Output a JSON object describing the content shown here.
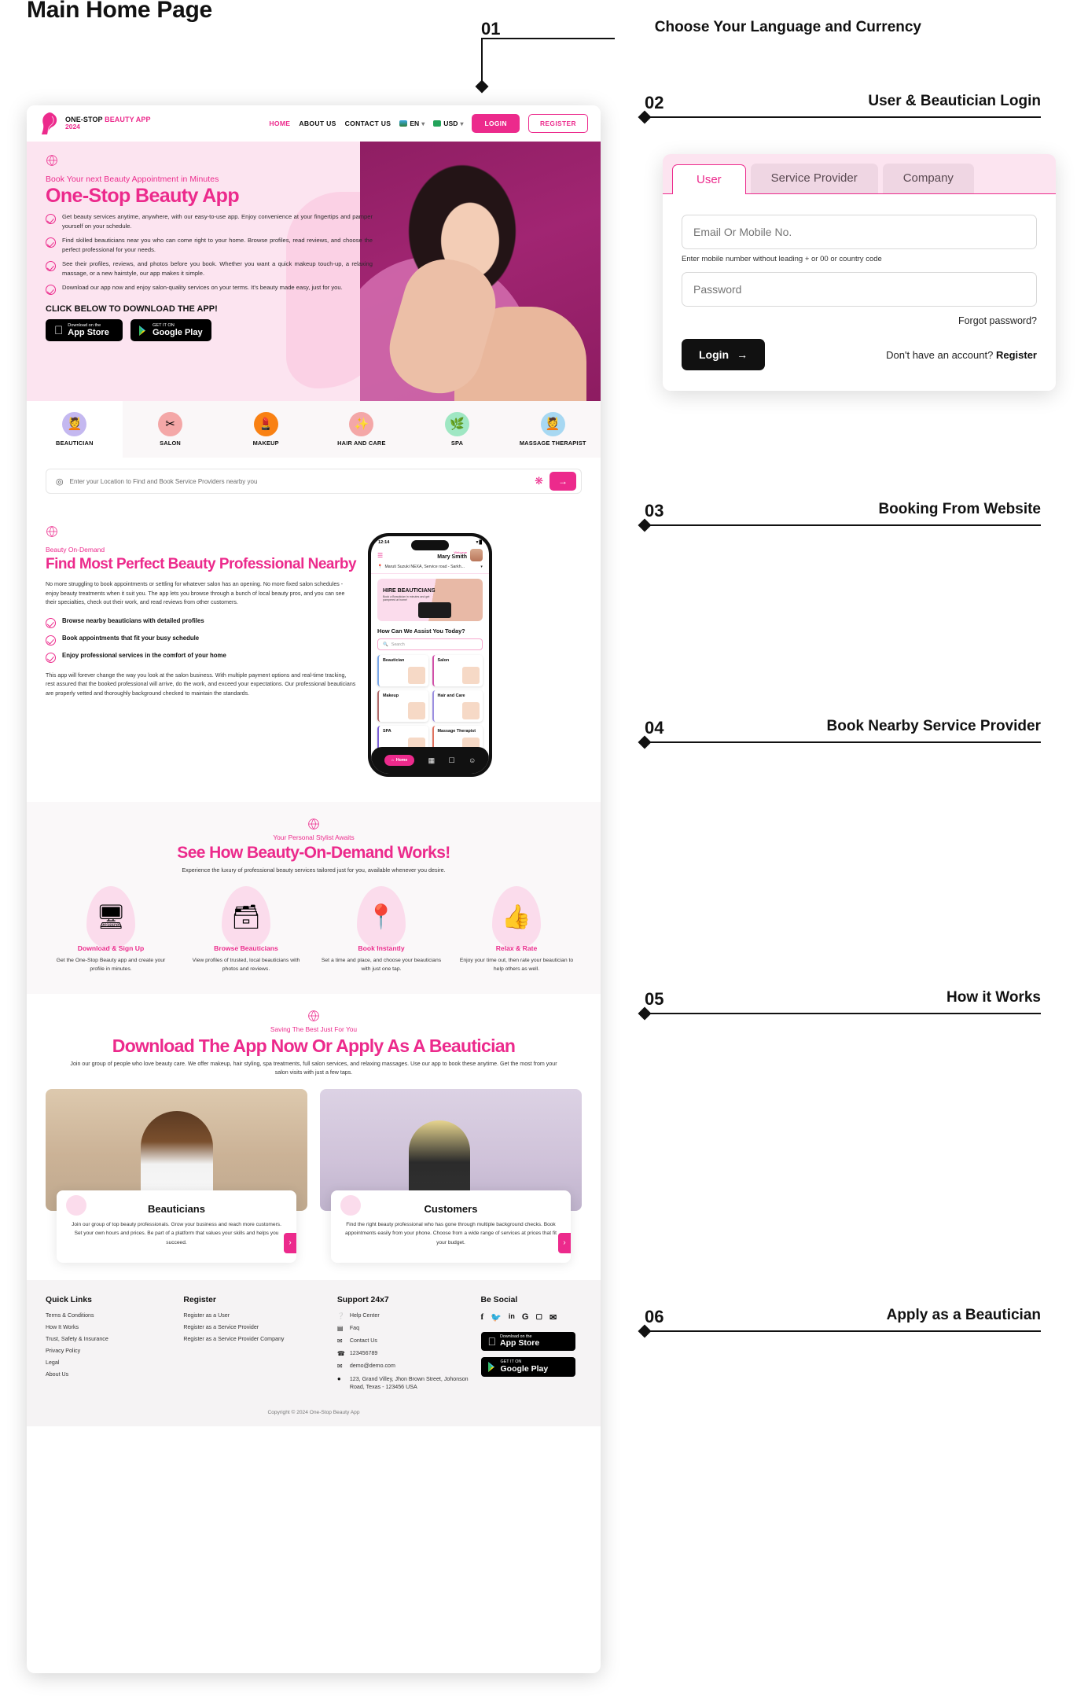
{
  "page_title": "Main Home Page",
  "callouts": [
    {
      "num": "01",
      "label": "Choose Your Language and Currency"
    },
    {
      "num": "02",
      "label": "User & Beautician Login"
    },
    {
      "num": "03",
      "label": "Booking From Website"
    },
    {
      "num": "04",
      "label": "Book Nearby Service Provider"
    },
    {
      "num": "05",
      "label": "How it Works"
    },
    {
      "num": "06",
      "label": "Apply as a Beautician"
    }
  ],
  "colors": {
    "accent": "#ec2a8c",
    "hero_bg": "#fce4f0",
    "photo_bg": "#8f1e63",
    "dark": "#111111"
  },
  "header": {
    "brand_line1_a": "ONE-STOP ",
    "brand_line1_b": "BEAUTY APP",
    "brand_line2": "2024",
    "nav": [
      {
        "label": "HOME",
        "active": true
      },
      {
        "label": "ABOUT US",
        "active": false
      },
      {
        "label": "CONTACT US",
        "active": false
      }
    ],
    "language": "EN",
    "currency": "USD",
    "login_label": "LOGIN",
    "register_label": "REGISTER"
  },
  "hero": {
    "kicker": "Book Your next Beauty Appointment in Minutes",
    "title": "One-Stop Beauty App",
    "bullets": [
      "Get beauty services anytime, anywhere, with our easy-to-use app. Enjoy convenience at your fingertips and pamper yourself on your schedule.",
      "Find skilled beauticians near you who can come right to your home. Browse profiles, read reviews, and choose the perfect professional for your needs.",
      "See their profiles, reviews, and photos before you book. Whether you want a quick makeup touch-up, a relaxing massage, or a new hairstyle, our app makes it simple.",
      "Download our app now and enjoy salon-quality services on your terms. It's beauty made easy, just for you."
    ],
    "cta_line": "CLICK BELOW TO DOWNLOAD THE APP!",
    "app_store": {
      "small": "Download on the",
      "big": "App Store"
    },
    "play_store": {
      "small": "GET IT ON",
      "big": "Google Play"
    }
  },
  "categories": [
    {
      "label": "BEAUTICIAN",
      "icon": "beautician-icon",
      "glyph": "💆",
      "bg": "#c4b8f0",
      "active": true
    },
    {
      "label": "SALON",
      "icon": "salon-icon",
      "glyph": "✂",
      "bg": "#f4a7a7",
      "active": false
    },
    {
      "label": "MAKEUP",
      "icon": "makeup-icon",
      "glyph": "💄",
      "bg": "#f98113",
      "active": false
    },
    {
      "label": "HAIR AND CARE",
      "icon": "hair-care-icon",
      "glyph": "💫",
      "bg": "#f4a7a7",
      "active": false
    },
    {
      "label": "SPA",
      "icon": "spa-icon",
      "glyph": "🌿",
      "bg": "#9fe7c3",
      "active": false
    },
    {
      "label": "MASSAGE THERAPIST",
      "icon": "massage-icon",
      "glyph": "💆",
      "bg": "#a7d8f2",
      "active": false
    }
  ],
  "location_search": {
    "placeholder": "Enter your Location to Find and Book Service Providers nearby you",
    "pin_icon": "location-pin-icon",
    "locate_icon": "crosshair-icon",
    "submit_icon": "arrow-right-icon"
  },
  "nearby": {
    "kicker": "Beauty On-Demand",
    "title": "Find Most Perfect Beauty Professional Nearby",
    "intro": "No more struggling to book appointments or settling for whatever salon has an opening. No more fixed salon schedules - enjoy beauty treatments when it suit you. The app lets you browse through a bunch of local beauty pros, and you can see their specialties, check out their work, and read reviews from other customers.",
    "bullets": [
      "Browse nearby beauticians with detailed profiles",
      "Book appointments that fit your busy schedule",
      "Enjoy professional services in the comfort of your home"
    ],
    "outro": "This app will forever change the way you look at the salon business. With multiple payment options and real-time tracking, rest assured that the booked professional will arrive, do the work, and exceed your expectations. Our professional beauticians are properly vetted and thoroughly background checked to maintain the standards."
  },
  "phone": {
    "time": "12:14",
    "welcome": "Welcome",
    "user_name": "Mary Smith",
    "location": "Maruti Suzuki NEXA, Service road - Sarkh...",
    "banner_title": "HIRE BEAUTICIANS",
    "banner_sub": "Book a Beautician in minutes and get pampered at home!",
    "question": "How Can We Assist You Today?",
    "search_placeholder": "Search",
    "grid": [
      "Beautician",
      "Salon",
      "Makeup",
      "Hair and Care",
      "SPA",
      "Massage Therapist"
    ],
    "nav_home": "Home"
  },
  "how_it_works": {
    "kicker": "Your Personal Stylist Awaits",
    "title": "See How Beauty-On-Demand Works!",
    "subtitle": "Experience the luxury of professional beauty services tailored just for you, available whenever you desire.",
    "steps": [
      {
        "icon": "signup-screen-icon",
        "glyph": "🖥",
        "title": "Download & Sign Up",
        "desc": "Get the One-Stop Beauty app and create your profile in minutes."
      },
      {
        "icon": "browse-grid-icon",
        "glyph": "🗂",
        "title": "Browse Beauticians",
        "desc": "View profiles of trusted, local beauticians with photos and reviews."
      },
      {
        "icon": "map-pin-icon",
        "glyph": "📍",
        "title": "Book Instantly",
        "desc": "Set a time and place, and choose your beauticians with just one tap."
      },
      {
        "icon": "thumbs-up-stars-icon",
        "glyph": "👍",
        "title": "Relax & Rate",
        "desc": "Enjoy your time out, then rate your beautician to help others as well."
      }
    ]
  },
  "download_apply": {
    "kicker": "Saving The Best Just For You",
    "title": "Download The App Now Or Apply As A Beautician",
    "subtitle": "Join our group of people who love beauty care. We offer makeup, hair styling, spa treatments, full salon services, and relaxing massages. Use our app to book these anytime. Get the most from your salon visits with just a few taps.",
    "cards": [
      {
        "title": "Beauticians",
        "desc": "Join our group of top beauty professionals. Grow your business and reach more customers. Set your own hours and prices. Be part of a platform that values your skills and helps you succeed.",
        "arrow_icon": "chevron-right-icon"
      },
      {
        "title": "Customers",
        "desc": "Find the right beauty professional who has gone through multiple background checks. Book appointments easily from your phone. Choose from a wide range of services at prices that fit your budget.",
        "arrow_icon": "chevron-right-icon"
      }
    ]
  },
  "footer": {
    "quick_links": {
      "heading": "Quick Links",
      "items": [
        "Terms & Conditions",
        "How It Works",
        "Trust, Safety & Insurance",
        "Privacy Policy",
        "Legal",
        "About Us"
      ]
    },
    "register": {
      "heading": "Register",
      "items": [
        "Register as a User",
        "Register as a Service Provider",
        "Register as a Service Provider Company"
      ]
    },
    "support": {
      "heading": "Support 24x7",
      "items": [
        {
          "icon": "help-circle-icon",
          "glyph": "?",
          "text": "Help Center"
        },
        {
          "icon": "faq-icon",
          "glyph": "☷",
          "text": "Faq"
        },
        {
          "icon": "contact-icon",
          "glyph": "✉",
          "text": "Contact Us"
        },
        {
          "icon": "phone-icon",
          "glyph": "☎",
          "text": "123456789"
        },
        {
          "icon": "mail-icon",
          "glyph": "✉",
          "text": "demo@demo.com"
        },
        {
          "icon": "location-pin-icon",
          "glyph": "📍",
          "text": "123, Grand Villey, Jhon Brown Street, Johonson Road, Texas - 123456 USA"
        }
      ]
    },
    "social": {
      "heading": "Be Social",
      "icons": [
        {
          "name": "facebook-icon",
          "glyph": "f"
        },
        {
          "name": "twitter-icon",
          "glyph": "𝒗"
        },
        {
          "name": "linkedin-icon",
          "glyph": "in"
        },
        {
          "name": "google-icon",
          "glyph": "G"
        },
        {
          "name": "instagram-icon",
          "glyph": "▢"
        },
        {
          "name": "email-icon",
          "glyph": "✉"
        }
      ],
      "app_store": {
        "small": "Download on the",
        "big": "App Store"
      },
      "play_store": {
        "small": "GET IT ON",
        "big": "Google Play"
      }
    },
    "copyright": "Copyright © 2024 One-Stop Beauty App"
  },
  "login_card": {
    "tabs": [
      {
        "label": "User",
        "active": true
      },
      {
        "label": "Service Provider",
        "active": false
      },
      {
        "label": "Company",
        "active": false
      }
    ],
    "email_placeholder": "Email Or Mobile No.",
    "hint": "Enter mobile number without leading + or 00 or country code",
    "password_placeholder": "Password",
    "forgot_label": "Forgot password?",
    "login_label": "Login",
    "login_arrow": "→",
    "register_prompt": "Don't have an account?",
    "register_label": "Register"
  }
}
